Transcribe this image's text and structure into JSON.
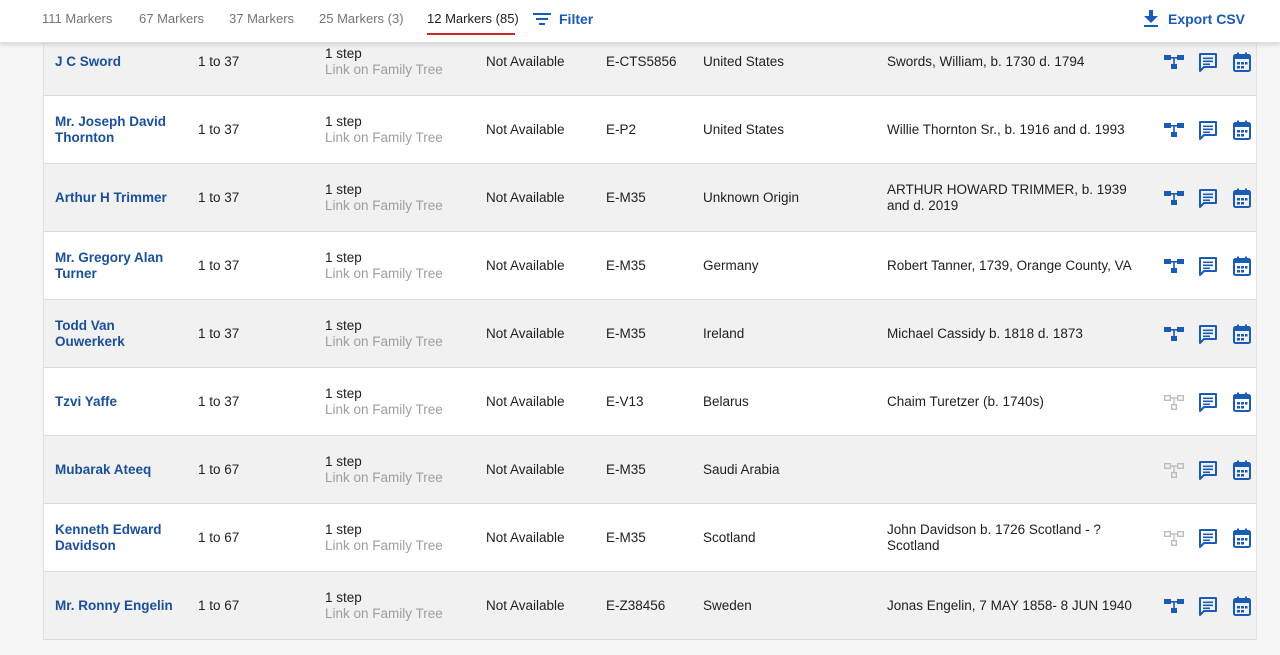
{
  "tabs": [
    {
      "label": "111 Markers"
    },
    {
      "label": "67 Markers"
    },
    {
      "label": "37 Markers"
    },
    {
      "label": "25 Markers (3)"
    },
    {
      "label": "12 Markers (85)",
      "active": true
    }
  ],
  "toolbar": {
    "filter_label": "Filter",
    "export_label": "Export CSV"
  },
  "colors": {
    "accent": "#1a5bb5",
    "name_link": "#1a4f9c",
    "tab_underline": "#c62828",
    "icon_active": "#1a5bb5",
    "icon_disabled": "#bdbdbd"
  },
  "icons": {
    "filter": "filter-lines-icon",
    "export": "download-icon",
    "tree": "family-tree-icon",
    "note": "message-note-icon",
    "calendar": "calendar-icon"
  },
  "rows": [
    {
      "name": "J C Sword",
      "range": "1 to 37",
      "step": "1 step",
      "step_link": "Link on Family Tree",
      "mdka": "Not Available",
      "haplogroup": "E-CTS5856",
      "origin": "United States",
      "ancestor": "Swords, William, b. 1730 d. 1794",
      "tree_active": true
    },
    {
      "name": "Mr. Joseph David Thornton",
      "range": "1 to 37",
      "step": "1 step",
      "step_link": "Link on Family Tree",
      "mdka": "Not Available",
      "haplogroup": "E-P2",
      "origin": "United States",
      "ancestor": "Willie Thornton Sr., b. 1916 and d. 1993",
      "tree_active": true
    },
    {
      "name": "Arthur H Trimmer",
      "range": "1 to 37",
      "step": "1 step",
      "step_link": "Link on Family Tree",
      "mdka": "Not Available",
      "haplogroup": "E-M35",
      "origin": "Unknown Origin",
      "ancestor": "ARTHUR HOWARD TRIMMER, b. 1939 and d. 2019",
      "tree_active": true
    },
    {
      "name": "Mr. Gregory Alan Turner",
      "range": "1 to 37",
      "step": "1 step",
      "step_link": "Link on Family Tree",
      "mdka": "Not Available",
      "haplogroup": "E-M35",
      "origin": "Germany",
      "ancestor": "Robert Tanner, 1739, Orange County, VA",
      "tree_active": true
    },
    {
      "name": "Todd Van Ouwerkerk",
      "range": "1 to 37",
      "step": "1 step",
      "step_link": "Link on Family Tree",
      "mdka": "Not Available",
      "haplogroup": "E-M35",
      "origin": "Ireland",
      "ancestor": "Michael Cassidy b. 1818 d. 1873",
      "tree_active": true
    },
    {
      "name": "Tzvi Yaffe",
      "range": "1 to 37",
      "step": "1 step",
      "step_link": "Link on Family Tree",
      "mdka": "Not Available",
      "haplogroup": "E-V13",
      "origin": "Belarus",
      "ancestor": "Chaim Turetzer (b. 1740s)",
      "tree_active": false
    },
    {
      "name": "Mubarak Ateeq",
      "range": "1 to 67",
      "step": "1 step",
      "step_link": "Link on Family Tree",
      "mdka": "Not Available",
      "haplogroup": "E-M35",
      "origin": "Saudi Arabia",
      "ancestor": "",
      "tree_active": false
    },
    {
      "name": "Kenneth Edward Davidson",
      "range": "1 to 67",
      "step": "1 step",
      "step_link": "Link on Family Tree",
      "mdka": "Not Available",
      "haplogroup": "E-M35",
      "origin": "Scotland",
      "ancestor": "John Davidson b. 1726 Scotland - ? Scotland",
      "tree_active": false
    },
    {
      "name": "Mr. Ronny Engelin",
      "range": "1 to 67",
      "step": "1 step",
      "step_link": "Link on Family Tree",
      "mdka": "Not Available",
      "haplogroup": "E-Z38456",
      "origin": "Sweden",
      "ancestor": "Jonas Engelin, 7 MAY 1858- 8 JUN 1940",
      "tree_active": true
    }
  ]
}
